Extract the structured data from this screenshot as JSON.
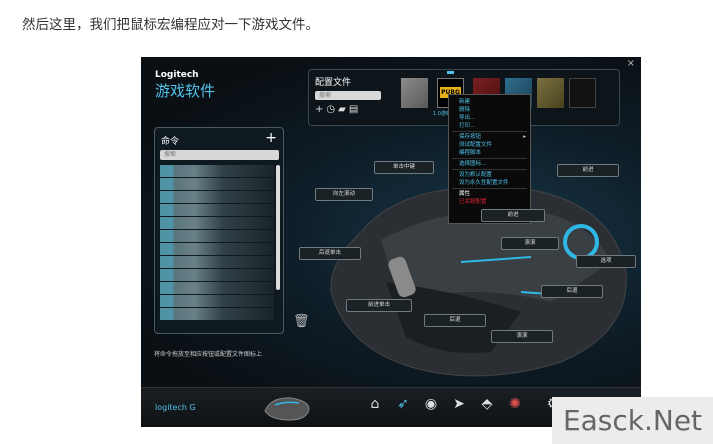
{
  "caption": "然后这里，我们把鼠标宏编程应对一下游戏文件。",
  "app": {
    "brand": "Logitech",
    "subtitle": "游戏软件",
    "close_glyph": "×"
  },
  "command_panel": {
    "title": "命令",
    "add_glyph": "+",
    "search_placeholder": "搜索",
    "hint": "将命令拖放至相应按钮或配置文件图标上"
  },
  "profile_panel": {
    "title": "配置文件",
    "search_placeholder": "搜索",
    "tool_icons": [
      "add-icon",
      "history-icon",
      "folder-icon",
      "print-icon"
    ],
    "selected_profile_logo": "PUBG",
    "selected_profile_name": "1.0游戏"
  },
  "context_menu": {
    "items": [
      "新建",
      "删除",
      "导出...",
      "打印...",
      "保存按钮",
      "测试配置文件",
      "编程脚本",
      "选择图标...",
      "设为默认配置",
      "设为永久性配置文件",
      "属性",
      "已关联配置"
    ]
  },
  "mouse_labels": [
    "单击中键",
    "向左滚动",
    "后退单击",
    "前进单击",
    "后退",
    "前进",
    "滚滚",
    "选项",
    "后退",
    "前进",
    "滚滚"
  ],
  "taskbar": {
    "logo": "logitech G"
  },
  "colors": {
    "accent": "#4fc3e9",
    "window_bg": "#0c1216",
    "menu_highlight": "#ffffff",
    "danger": "#dd2233"
  },
  "watermark": "Easck.Net"
}
